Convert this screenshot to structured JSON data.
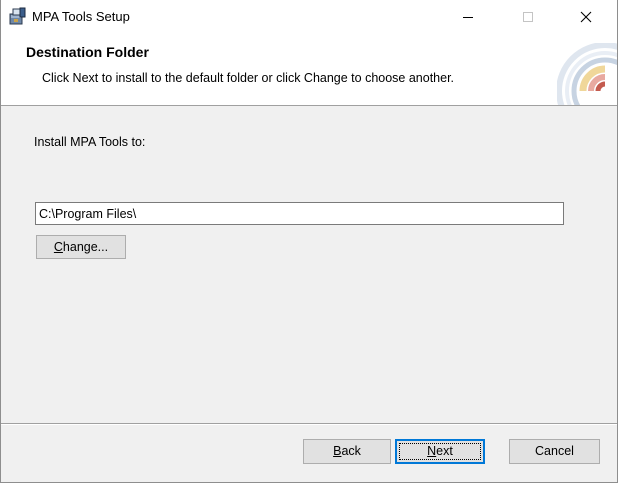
{
  "window": {
    "title": "MPA Tools Setup",
    "icon": "installer-package-icon"
  },
  "caption_buttons": {
    "minimize_icon": "minimize-icon",
    "maximize_icon": "maximize-icon",
    "close_icon": "close-icon"
  },
  "banner": {
    "title": "Destination Folder",
    "description": "Click Next to install to the default folder or click Change to choose another.",
    "graphic_icon": "installer-banner-graphic"
  },
  "body": {
    "install_label": "Install MPA Tools to:",
    "install_path": "C:\\Program Files\\",
    "change_button": {
      "mnemonic": "C",
      "rest": "hange..."
    }
  },
  "footer": {
    "back_button": {
      "mnemonic": "B",
      "rest": "ack"
    },
    "next_button": {
      "mnemonic": "N",
      "rest": "ext"
    },
    "cancel_label": "Cancel"
  },
  "colors": {
    "dialog_background": "#f0f0f0",
    "banner_background": "#ffffff",
    "button_face": "#e1e1e1",
    "default_button_border": "#0078d7"
  }
}
